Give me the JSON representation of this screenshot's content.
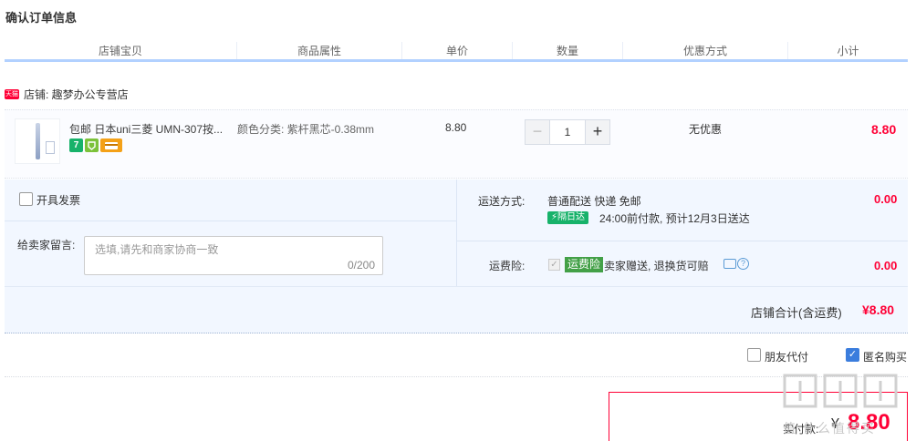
{
  "page": {
    "title": "确认订单信息"
  },
  "columns": [
    "店铺宝贝",
    "商品属性",
    "单价",
    "数量",
    "优惠方式",
    "小计"
  ],
  "shop": {
    "badge": "天猫",
    "label": "店铺: 趣梦办公专营店"
  },
  "item": {
    "title": "包邮 日本uni三菱 UMN-307按...",
    "attribute": "颜色分类: 紫杆黑芯-0.38mm",
    "unit_price": "8.80",
    "quantity": "1",
    "minus_symbol": "−",
    "plus_symbol": "+",
    "discount": "无优惠",
    "subtotal": "8.80",
    "badges": [
      {
        "text": "7",
        "icon": "seven-day-return-icon",
        "color": "#17b26a"
      },
      {
        "text": "",
        "icon": "guarantee-icon",
        "color": "#7cc23a"
      },
      {
        "text": "",
        "icon": "credit-card-icon",
        "color": "#f4a118"
      }
    ]
  },
  "invoice": {
    "label": "开具发票",
    "checked": false
  },
  "message": {
    "label": "给卖家留言:",
    "placeholder": "选填,请先和商家协商一致",
    "counter": "0/200"
  },
  "shipping": {
    "label": "运送方式:",
    "method": "普通配送 快递 免邮",
    "fee": "0.00",
    "next_day_badge": "隔日达",
    "delivery_note": "24:00前付款, 预计12月3日送达"
  },
  "insurance": {
    "label": "运费险:",
    "tag": "运费险",
    "description": "卖家赠送, 退换货可赔",
    "fee": "0.00",
    "help_symbol": "?"
  },
  "shop_total": {
    "label": "店铺合计(含运费)",
    "value": "¥8.80"
  },
  "options": {
    "friend_pay": {
      "label": "朋友代付",
      "checked": false
    },
    "anonymous": {
      "label": "匿名购买",
      "checked": true,
      "check_symbol": "✓"
    }
  },
  "payment": {
    "label": "实付款:",
    "symbol": "¥",
    "value": "8.80"
  },
  "watermark": "值 什么值得买",
  "colors": {
    "accent_red": "#ff0036",
    "header_line": "#b2d1ff",
    "panel_bg": "#f2f7ff",
    "checkbox_blue": "#3b7ddd"
  }
}
